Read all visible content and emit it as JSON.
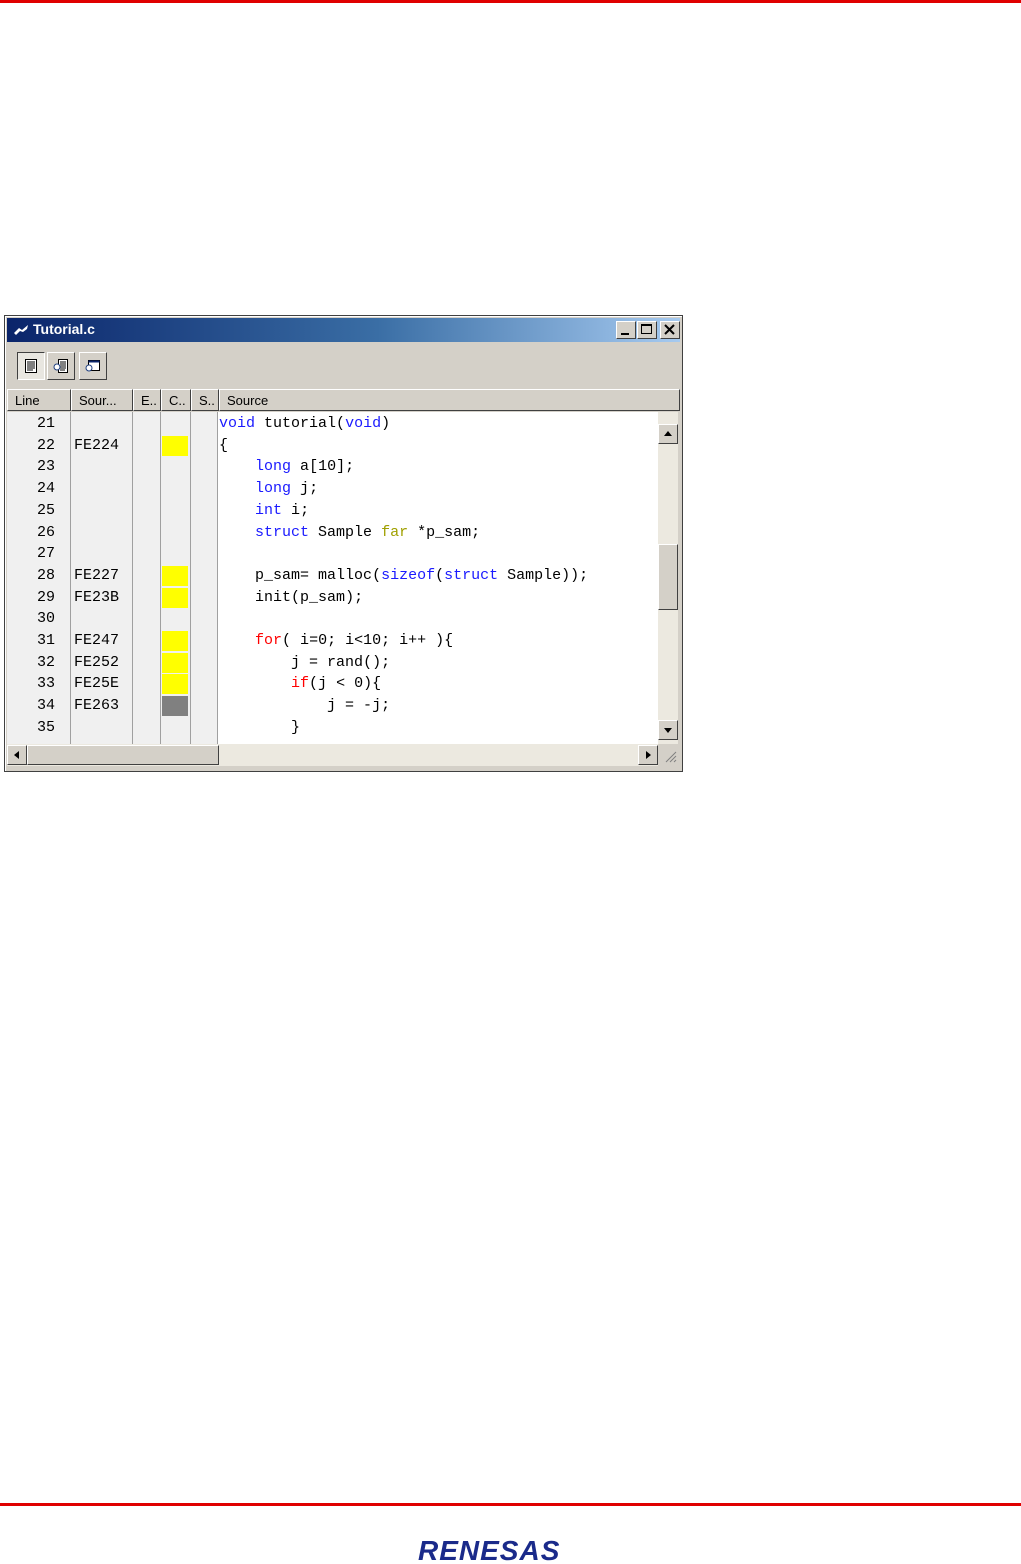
{
  "window": {
    "title": "Tutorial.c",
    "buttons": [
      "_",
      "□",
      "×"
    ]
  },
  "toolbar": {
    "icons": [
      "source-mode-icon",
      "mixed-mode-icon",
      "disassembly-mode-icon"
    ]
  },
  "columns": [
    "Line",
    "Sour...",
    "E..",
    "C..",
    "S..",
    "Source"
  ],
  "colors": {
    "coverage_hit": "#ffff00",
    "coverage_partial": "#808080",
    "keyword_blue": "#1a1aff",
    "keyword_red": "#ff0000",
    "brand_red": "#e00000"
  },
  "rows": [
    {
      "line": "21",
      "addr": "",
      "coverage": "none",
      "source": "void tutorial(void)"
    },
    {
      "line": "22",
      "addr": "FE224",
      "coverage": "hit",
      "source": "{"
    },
    {
      "line": "23",
      "addr": "",
      "coverage": "none",
      "source": "    long a[10];"
    },
    {
      "line": "24",
      "addr": "",
      "coverage": "none",
      "source": "    long j;"
    },
    {
      "line": "25",
      "addr": "",
      "coverage": "none",
      "source": "    int i;"
    },
    {
      "line": "26",
      "addr": "",
      "coverage": "none",
      "source": "    struct Sample far *p_sam;"
    },
    {
      "line": "27",
      "addr": "",
      "coverage": "none",
      "source": ""
    },
    {
      "line": "28",
      "addr": "FE227",
      "coverage": "hit",
      "source": "    p_sam= malloc(sizeof(struct Sample));"
    },
    {
      "line": "29",
      "addr": "FE23B",
      "coverage": "hit",
      "source": "    init(p_sam);"
    },
    {
      "line": "30",
      "addr": "",
      "coverage": "none",
      "source": ""
    },
    {
      "line": "31",
      "addr": "FE247",
      "coverage": "hit",
      "source": "    for( i=0; i<10; i++ ){"
    },
    {
      "line": "32",
      "addr": "FE252",
      "coverage": "hit",
      "source": "        j = rand();"
    },
    {
      "line": "33",
      "addr": "FE25E",
      "coverage": "hit",
      "source": "        if(j < 0){"
    },
    {
      "line": "34",
      "addr": "FE263",
      "coverage": "partial",
      "source": "            j = -j;"
    },
    {
      "line": "35",
      "addr": "",
      "coverage": "none",
      "source": "        }"
    }
  ],
  "footer": {
    "logo_text": "RENESAS"
  }
}
